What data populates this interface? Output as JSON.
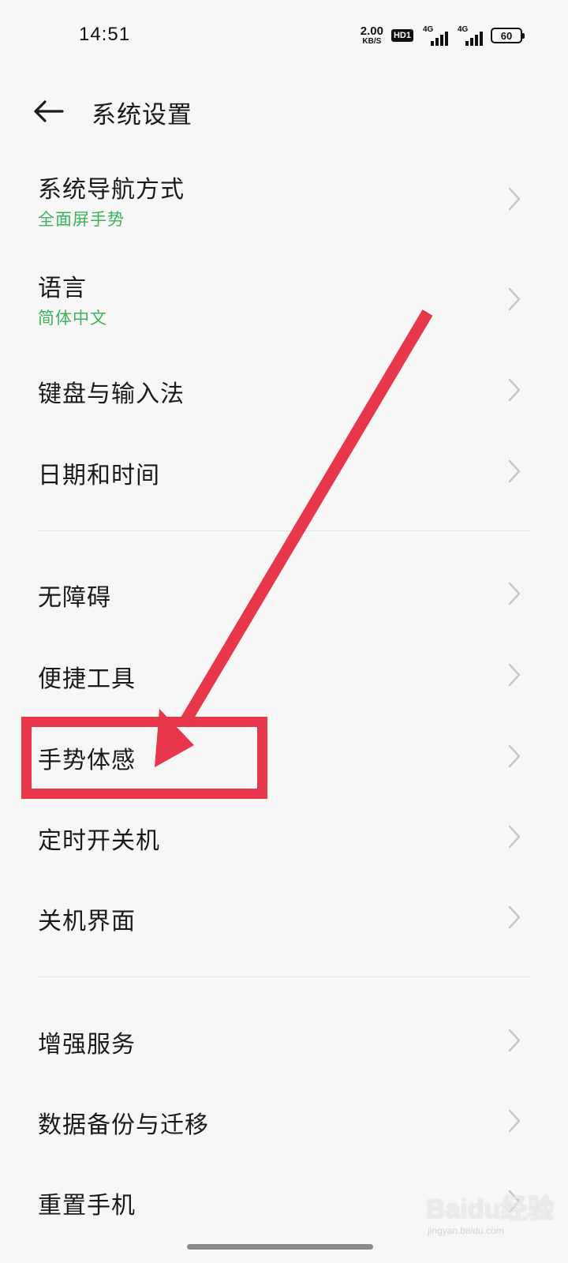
{
  "status_bar": {
    "time": "14:51",
    "net_speed": "2.00",
    "net_unit": "KB/S",
    "hd_badge": "HD1",
    "signal1_label": "4G",
    "signal2_label": "4G",
    "battery": "60"
  },
  "header": {
    "title": "系统设置"
  },
  "settings": [
    {
      "label": "系统导航方式",
      "sub": "全面屏手势"
    },
    {
      "label": "语言",
      "sub": "简体中文"
    },
    {
      "label": "键盘与输入法"
    },
    {
      "label": "日期和时间"
    },
    {
      "label": "无障碍"
    },
    {
      "label": "便捷工具"
    },
    {
      "label": "手势体感"
    },
    {
      "label": "定时开关机"
    },
    {
      "label": "关机界面"
    },
    {
      "label": "增强服务"
    },
    {
      "label": "数据备份与迁移"
    },
    {
      "label": "重置手机"
    }
  ],
  "watermark": {
    "brand": "Baidu经验",
    "url": "jingyan.baidu.com"
  },
  "colors": {
    "accent_green": "#3cb35a",
    "annotation_red": "#e8364a",
    "background": "#f7f7f7"
  }
}
